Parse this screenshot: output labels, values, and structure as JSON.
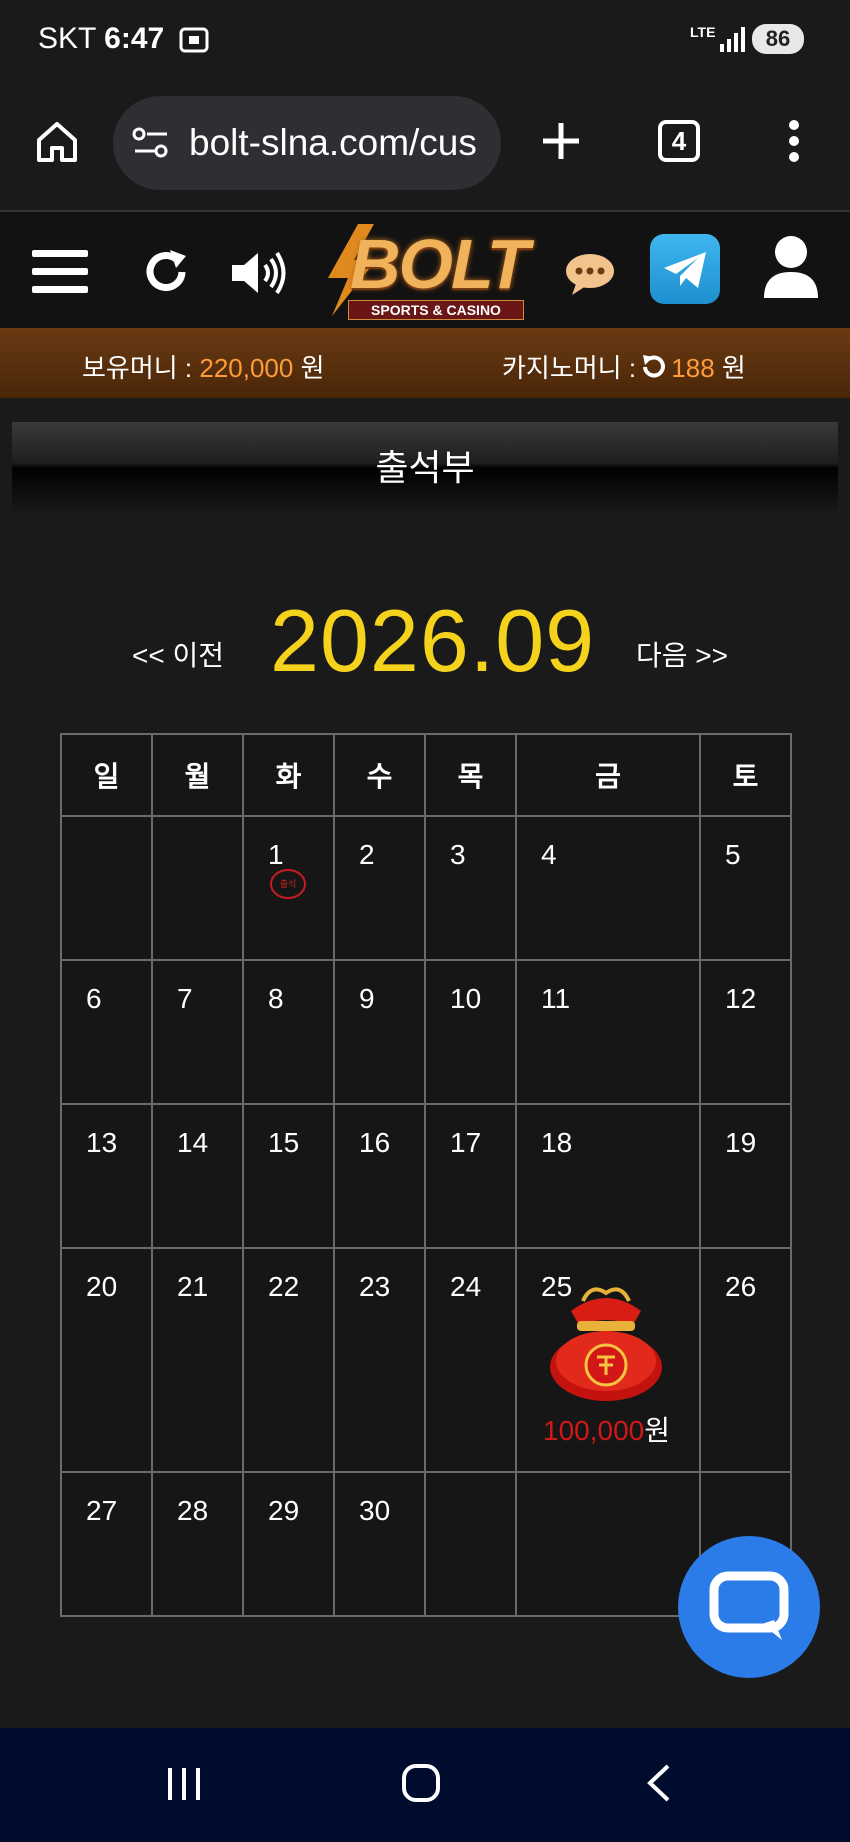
{
  "status_bar": {
    "carrier": "SKT",
    "time": "6:47",
    "network": "LTE",
    "battery": "86"
  },
  "browser": {
    "url": "bolt-slna.com/cus",
    "tab_count": "4"
  },
  "site": {
    "logo": "BOLT",
    "logo_sub": "SPORTS & CASINO"
  },
  "money": {
    "held_label": "보유머니 : ",
    "held_value": "220,000",
    "held_unit": " 원",
    "casino_label": "카지노머니 : ",
    "casino_value": "188",
    "casino_unit": " 원"
  },
  "page_title": "출석부",
  "calendar": {
    "prev_label": "<< 이전",
    "next_label": "다음 >>",
    "month": "2026.09",
    "weekdays": [
      "일",
      "월",
      "화",
      "수",
      "목",
      "금",
      "토"
    ],
    "weeks": [
      [
        "",
        "",
        "1",
        "2",
        "3",
        "4",
        "5"
      ],
      [
        "6",
        "7",
        "8",
        "9",
        "10",
        "11",
        "12"
      ],
      [
        "13",
        "14",
        "15",
        "16",
        "17",
        "18",
        "19"
      ],
      [
        "20",
        "21",
        "22",
        "23",
        "24",
        "25",
        "26"
      ],
      [
        "27",
        "28",
        "29",
        "30",
        "",
        "",
        ""
      ]
    ],
    "stamp_text": "출석",
    "reward_amount": "100,000",
    "reward_unit": "원"
  },
  "colors": {
    "accent_yellow": "#f5d31c",
    "money_orange": "#ff9b3a",
    "reward_red": "#d31717",
    "fab_blue": "#2b7ce8",
    "telegram_blue": "#2aa3e0"
  }
}
